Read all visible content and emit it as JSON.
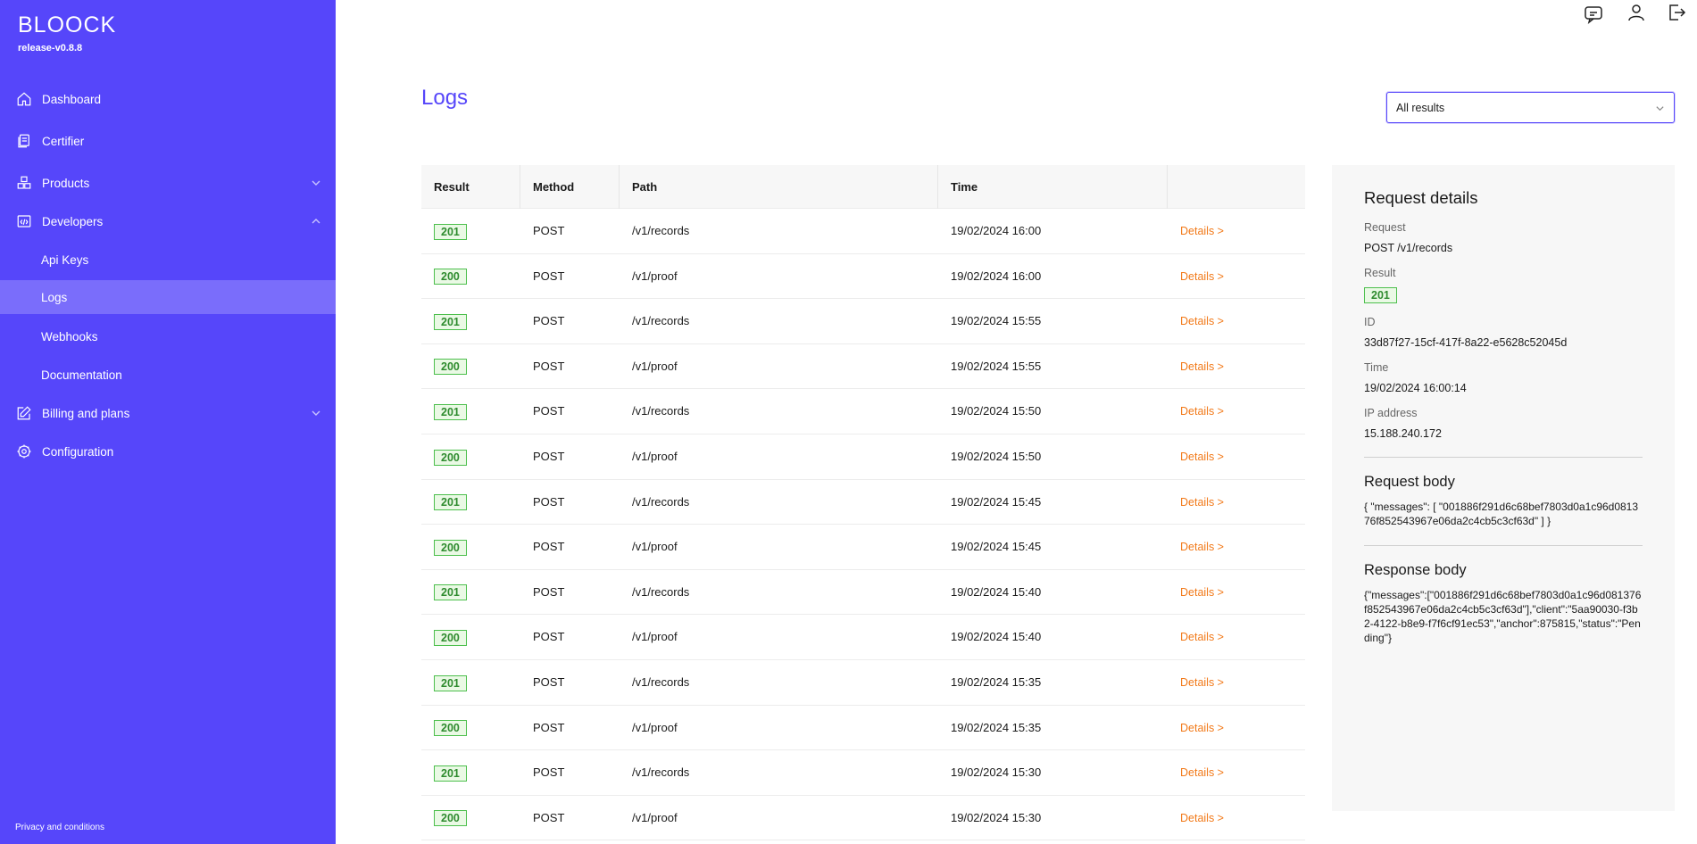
{
  "sidebar": {
    "logo": "BLOOCK",
    "version": "release-v0.8.8",
    "items": [
      {
        "label": "Dashboard"
      },
      {
        "label": "Certifier"
      },
      {
        "label": "Products"
      },
      {
        "label": "Developers"
      },
      {
        "label": "Api Keys"
      },
      {
        "label": "Logs"
      },
      {
        "label": "Webhooks"
      },
      {
        "label": "Documentation"
      },
      {
        "label": "Billing and plans"
      },
      {
        "label": "Configuration"
      }
    ],
    "footer": "Privacy and conditions"
  },
  "topbar": {
    "icons": [
      "chat-icon",
      "user-icon",
      "logout-icon"
    ]
  },
  "page": {
    "title": "Logs",
    "filter": {
      "selected": "All results"
    }
  },
  "table": {
    "columns": [
      "Result",
      "Method",
      "Path",
      "Time"
    ],
    "details_label": "Details >",
    "rows": [
      {
        "result": "201",
        "method": "POST",
        "path": "/v1/records",
        "time": "19/02/2024 16:00"
      },
      {
        "result": "200",
        "method": "POST",
        "path": "/v1/proof",
        "time": "19/02/2024 16:00"
      },
      {
        "result": "201",
        "method": "POST",
        "path": "/v1/records",
        "time": "19/02/2024 15:55"
      },
      {
        "result": "200",
        "method": "POST",
        "path": "/v1/proof",
        "time": "19/02/2024 15:55"
      },
      {
        "result": "201",
        "method": "POST",
        "path": "/v1/records",
        "time": "19/02/2024 15:50"
      },
      {
        "result": "200",
        "method": "POST",
        "path": "/v1/proof",
        "time": "19/02/2024 15:50"
      },
      {
        "result": "201",
        "method": "POST",
        "path": "/v1/records",
        "time": "19/02/2024 15:45"
      },
      {
        "result": "200",
        "method": "POST",
        "path": "/v1/proof",
        "time": "19/02/2024 15:45"
      },
      {
        "result": "201",
        "method": "POST",
        "path": "/v1/records",
        "time": "19/02/2024 15:40"
      },
      {
        "result": "200",
        "method": "POST",
        "path": "/v1/proof",
        "time": "19/02/2024 15:40"
      },
      {
        "result": "201",
        "method": "POST",
        "path": "/v1/records",
        "time": "19/02/2024 15:35"
      },
      {
        "result": "200",
        "method": "POST",
        "path": "/v1/proof",
        "time": "19/02/2024 15:35"
      },
      {
        "result": "201",
        "method": "POST",
        "path": "/v1/records",
        "time": "19/02/2024 15:30"
      },
      {
        "result": "200",
        "method": "POST",
        "path": "/v1/proof",
        "time": "19/02/2024 15:30"
      }
    ]
  },
  "details": {
    "title": "Request details",
    "request_label": "Request",
    "request_value": "POST /v1/records",
    "result_label": "Result",
    "result_value": "201",
    "id_label": "ID",
    "id_value": "33d87f27-15cf-417f-8a22-e5628c52045d",
    "time_label": "Time",
    "time_value": "19/02/2024 16:00:14",
    "ip_label": "IP address",
    "ip_value": "15.188.240.172",
    "request_body_title": "Request body",
    "request_body": "{ \"messages\": [ \"001886f291d6c68bef7803d0a1c96d081376f852543967e06da2c4cb5c3cf63d\" ] }",
    "response_body_title": "Response body",
    "response_body": "{\"messages\":[\"001886f291d6c68bef7803d0a1c96d081376f852543967e06da2c4cb5c3cf63d\"],\"client\":\"5aa90030-f3b2-4122-b8e9-f7f6cf91ec53\",\"anchor\":875815,\"status\":\"Pending\"}"
  },
  "colors": {
    "primary": "#5646fa",
    "active": "#7a6dfb",
    "success": "#4cbf4c",
    "link": "#f27a1a"
  }
}
